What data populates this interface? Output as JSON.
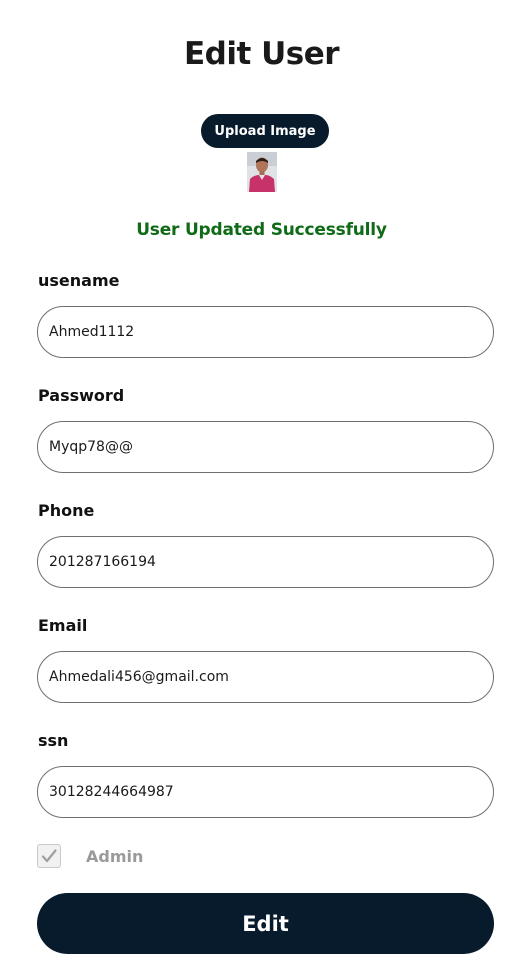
{
  "page": {
    "title": "Edit User",
    "upload_label": "Upload Image",
    "avatar_icon": "user-avatar-photo",
    "status_message": "User Updated Successfully",
    "status_color": "#0f6b17",
    "accent_color": "#081b2c"
  },
  "form": {
    "username": {
      "label": "usename",
      "value": "Ahmed1112"
    },
    "password": {
      "label": "Password",
      "value": "Myqp78@@"
    },
    "phone": {
      "label": "Phone",
      "value": "201287166194"
    },
    "email": {
      "label": "Email",
      "value": "Ahmedali456@gmail.com"
    },
    "ssn": {
      "label": "ssn",
      "value": "30128244664987"
    },
    "admin": {
      "label": "Admin",
      "checked": true,
      "disabled": true,
      "icon": "check-icon"
    },
    "submit_label": "Edit"
  }
}
